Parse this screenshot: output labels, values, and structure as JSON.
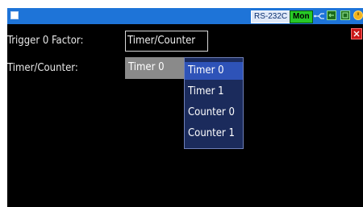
{
  "status_bar": {
    "interface": "RS-232C",
    "mode": "Mon",
    "icons": [
      "menu-icon",
      "usb-icon",
      "network-icon",
      "memory-card-icon",
      "power-icon"
    ],
    "colors": {
      "bar": "#1e74d8",
      "mon_badge": "#27c927"
    }
  },
  "form": {
    "trigger_label": "Trigger 0 Factor:",
    "trigger_value": "Timer/Counter",
    "timer_counter_label": "Timer/Counter:",
    "timer_counter_value": "Timer 0"
  },
  "dropdown": {
    "options": [
      {
        "label": "Timer 0",
        "selected": true
      },
      {
        "label": "Timer 1",
        "selected": false
      },
      {
        "label": "Counter 0",
        "selected": false
      },
      {
        "label": "Counter 1",
        "selected": false
      }
    ]
  },
  "close_icon": "close-icon",
  "colors": {
    "background": "#000000",
    "dropdown": "#1b2b5c",
    "highlight": "#2e53b8",
    "close": "#c81818"
  }
}
